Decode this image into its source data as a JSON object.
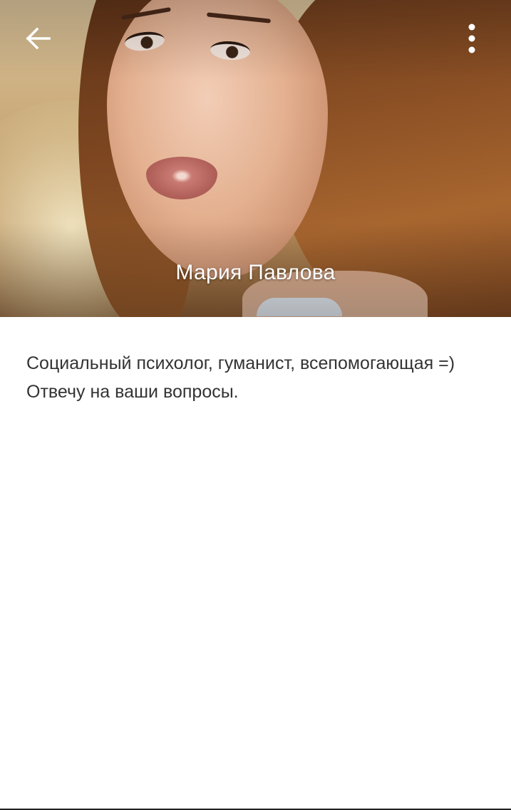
{
  "profile": {
    "name": "Мария Павлова",
    "bio": "Социальный психолог, гуманист, всепомогающая =) Отвечу на ваши вопросы."
  },
  "header": {
    "back_icon": "arrow-left-icon",
    "menu_icon": "more-vertical-icon"
  },
  "colors": {
    "name_text": "#ffffff",
    "bio_text": "#333333",
    "background": "#ffffff"
  }
}
